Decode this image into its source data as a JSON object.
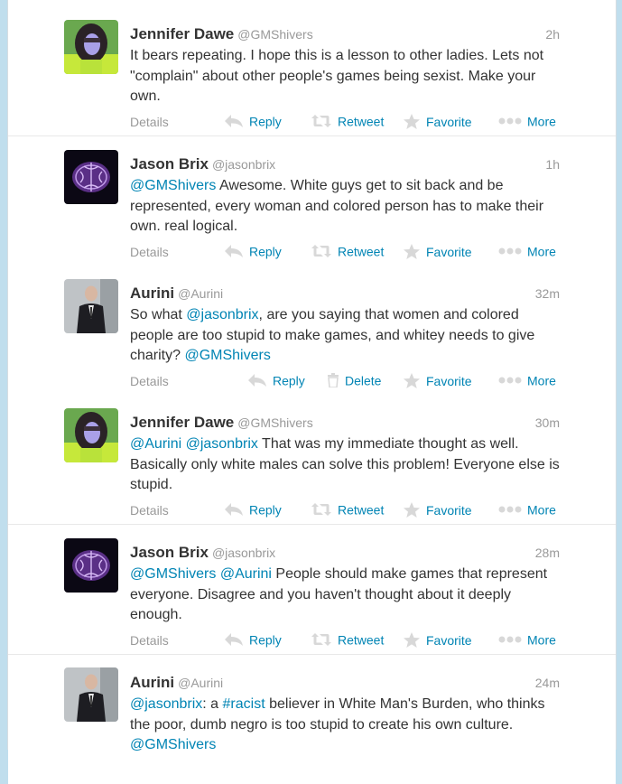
{
  "actions": {
    "details": "Details",
    "reply": "Reply",
    "retweet": "Retweet",
    "delete": "Delete",
    "favorite": "Favorite",
    "more": "More"
  },
  "avatars": {
    "jennifer": "woman-green-hair-photo",
    "jason": "purple-brain-image",
    "aurini": "man-in-suit-photo"
  },
  "colors": {
    "link": "#0084b4",
    "background": "#c0deed",
    "muted": "#999999"
  },
  "tweets": [
    {
      "name": "Jennifer Dawe",
      "handle": "@GMShivers",
      "time": "2h",
      "parts": [
        "It bears repeating. I hope this is a lesson to other ladies. Lets not \"complain\" about other people's games being sexist. Make your own."
      ]
    },
    {
      "name": "Jason Brix",
      "handle": "@jasonbrix",
      "time": "1h",
      "parts": [
        "@GMShivers",
        " Awesome. White guys get to sit back and be represented, every woman and colored person has to make their own. real logical."
      ]
    },
    {
      "name": "Aurini",
      "handle": "@Aurini",
      "time": "32m",
      "parts": [
        "So what ",
        "@jasonbrix",
        ", are you saying that women and colored people are too stupid to make games, and whitey needs to give charity? ",
        "@GMShivers"
      ]
    },
    {
      "name": "Jennifer Dawe",
      "handle": "@GMShivers",
      "time": "30m",
      "parts": [
        "@Aurini",
        " ",
        "@jasonbrix",
        " That was my immediate thought as well. Basically only white males can solve this problem! Everyone else is stupid."
      ]
    },
    {
      "name": "Jason Brix",
      "handle": "@jasonbrix",
      "time": "28m",
      "parts": [
        "@GMShivers",
        " ",
        "@Aurini",
        " People should make games that represent everyone. Disagree and you haven't thought about it deeply enough."
      ]
    },
    {
      "name": "Aurini",
      "handle": "@Aurini",
      "time": "24m",
      "parts": [
        "@jasonbrix",
        ": a ",
        "#racist",
        " believer in White Man's Burden, who thinks the poor, dumb negro is too stupid to create his own culture. ",
        "@GMShivers"
      ]
    }
  ]
}
